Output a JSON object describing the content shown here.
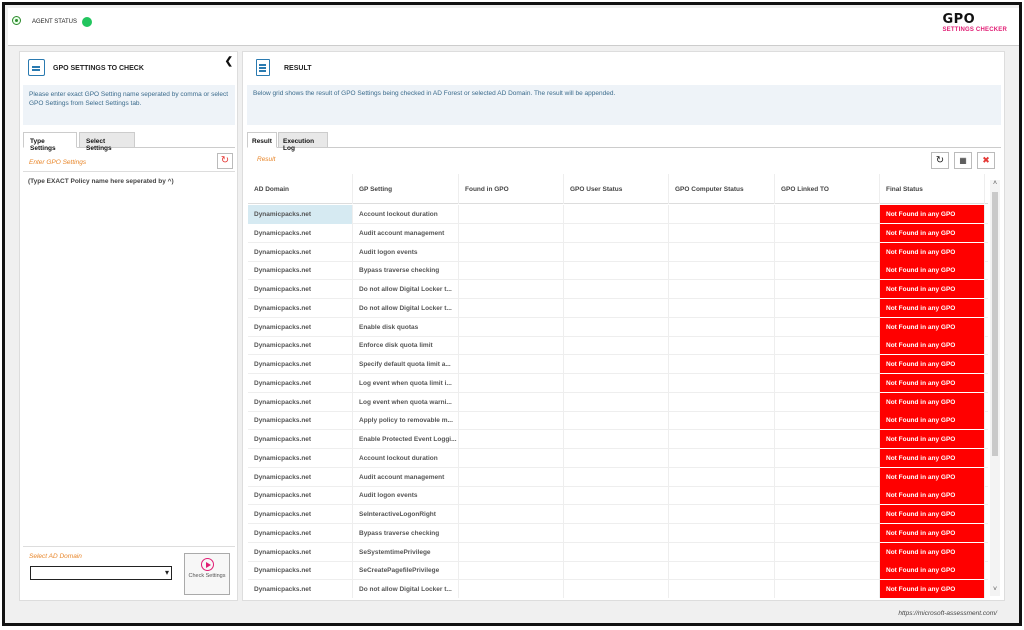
{
  "topbar": {
    "agent_label": "AGENT STATUS",
    "agent_status_color": "#22c55e",
    "brand_title": "GPO",
    "brand_sub": "SETTINGS CHECKER"
  },
  "left": {
    "title": "GPO SETTINGS TO CHECK",
    "collapse_icon": "chevron-left-icon",
    "info": "Please enter exact GPO Setting name seperated by comma or select GPO Settings from Select Settings tab.",
    "tabs": [
      "Type Settings",
      "Select Settings"
    ],
    "enter_label": "Enter GPO Settings",
    "type_hint": "(Type EXACT Policy name here seperated by ^)",
    "domain_label": "Select AD Domain",
    "domain_value": "",
    "check_button": "Check Settings"
  },
  "right": {
    "title": "RESULT",
    "description": "Below grid shows the result of GPO Settings being checked in AD Forest or selected AD Domain. The result will be appended.",
    "tabs": [
      "Result",
      "Execution Log"
    ],
    "result_label": "Result",
    "columns": [
      "AD Domain",
      "GP Setting",
      "Found in GPO",
      "GPO User Status",
      "GPO Computer Status",
      "GPO Linked TO",
      "Final Status"
    ],
    "rows": [
      [
        "Dynamicpacks.net",
        "Account lockout duration",
        "",
        "",
        "",
        "",
        "Not Found in any GPO"
      ],
      [
        "Dynamicpacks.net",
        "Audit account management",
        "",
        "",
        "",
        "",
        "Not Found in any GPO"
      ],
      [
        "Dynamicpacks.net",
        "Audit logon events",
        "",
        "",
        "",
        "",
        "Not Found in any GPO"
      ],
      [
        "Dynamicpacks.net",
        "Bypass traverse checking",
        "",
        "",
        "",
        "",
        "Not Found in any GPO"
      ],
      [
        "Dynamicpacks.net",
        "Do not allow Digital Locker t...",
        "",
        "",
        "",
        "",
        "Not Found in any GPO"
      ],
      [
        "Dynamicpacks.net",
        "Do not allow Digital Locker t...",
        "",
        "",
        "",
        "",
        "Not Found in any GPO"
      ],
      [
        "Dynamicpacks.net",
        "Enable disk quotas",
        "",
        "",
        "",
        "",
        "Not Found in any GPO"
      ],
      [
        "Dynamicpacks.net",
        "Enforce disk quota limit",
        "",
        "",
        "",
        "",
        "Not Found in any GPO"
      ],
      [
        "Dynamicpacks.net",
        "Specify default quota limit a...",
        "",
        "",
        "",
        "",
        "Not Found in any GPO"
      ],
      [
        "Dynamicpacks.net",
        "Log event when quota limit i...",
        "",
        "",
        "",
        "",
        "Not Found in any GPO"
      ],
      [
        "Dynamicpacks.net",
        "Log event when quota warni...",
        "",
        "",
        "",
        "",
        "Not Found in any GPO"
      ],
      [
        "Dynamicpacks.net",
        "Apply policy to removable m...",
        "",
        "",
        "",
        "",
        "Not Found in any GPO"
      ],
      [
        "Dynamicpacks.net",
        "Enable Protected Event Loggi...",
        "",
        "",
        "",
        "",
        "Not Found in any GPO"
      ],
      [
        "Dynamicpacks.net",
        "Account lockout duration",
        "",
        "",
        "",
        "",
        "Not Found in any GPO"
      ],
      [
        "Dynamicpacks.net",
        "Audit account management",
        "",
        "",
        "",
        "",
        "Not Found in any GPO"
      ],
      [
        "Dynamicpacks.net",
        "Audit logon events",
        "",
        "",
        "",
        "",
        "Not Found in any GPO"
      ],
      [
        "Dynamicpacks.net",
        "SeInteractiveLogonRight",
        "",
        "",
        "",
        "",
        "Not Found in any GPO"
      ],
      [
        "Dynamicpacks.net",
        "Bypass traverse checking",
        "",
        "",
        "",
        "",
        "Not Found in any GPO"
      ],
      [
        "Dynamicpacks.net",
        "SeSystemtimePrivilege",
        "",
        "",
        "",
        "",
        "Not Found in any GPO"
      ],
      [
        "Dynamicpacks.net",
        "SeCreatePagefilePrivilege",
        "",
        "",
        "",
        "",
        "Not Found in any GPO"
      ],
      [
        "Dynamicpacks.net",
        "Do not allow Digital Locker t...",
        "",
        "",
        "",
        "",
        "Not Found in any GPO"
      ]
    ],
    "status_color": "#ff0000",
    "selected_color": "#d6eaf2"
  },
  "footer": {
    "url": "https://microsoft-assessment.com/"
  }
}
